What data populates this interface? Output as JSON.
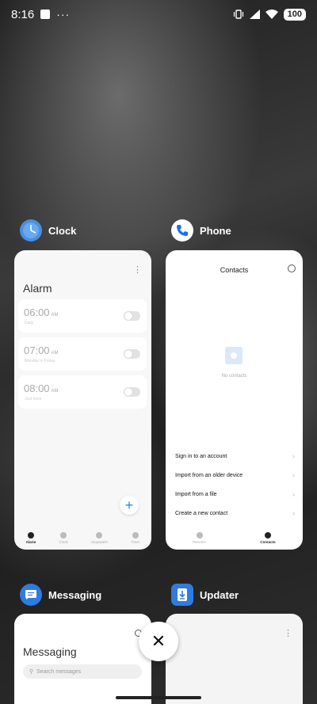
{
  "status_bar": {
    "time": "8:16",
    "overflow": "···",
    "battery": "100"
  },
  "apps": [
    {
      "name": "Clock"
    },
    {
      "name": "Phone"
    },
    {
      "name": "Messaging"
    },
    {
      "name": "Updater"
    }
  ],
  "clock_card": {
    "title": "Alarm",
    "alarms": [
      {
        "time": "06:00",
        "ampm": "AM",
        "sub": "Daily",
        "enabled": false
      },
      {
        "time": "07:00",
        "ampm": "AM",
        "sub": "Monday to Friday",
        "enabled": false
      },
      {
        "time": "08:00",
        "ampm": "AM",
        "sub": "Just once",
        "enabled": false
      }
    ],
    "fab": "+",
    "nav": [
      "Alarm",
      "Clock",
      "Stopwatch",
      "Timer"
    ]
  },
  "phone_card": {
    "title": "Contacts",
    "empty_text": "No contacts",
    "actions": [
      "Sign in to an account",
      "Import from an older device",
      "Import from a file",
      "Create a new contact"
    ],
    "nav": [
      "Recents",
      "Contacts"
    ]
  },
  "messaging_card": {
    "title": "Messaging",
    "search_placeholder": "Search messages"
  },
  "close_button": "✕",
  "colors": {
    "accent": "#2e86f3",
    "clock_icon": "#4a8fe0",
    "phone_icon": "#1a73e8",
    "messaging_icon": "#2f7be0",
    "updater_icon": "#2f7be0"
  }
}
